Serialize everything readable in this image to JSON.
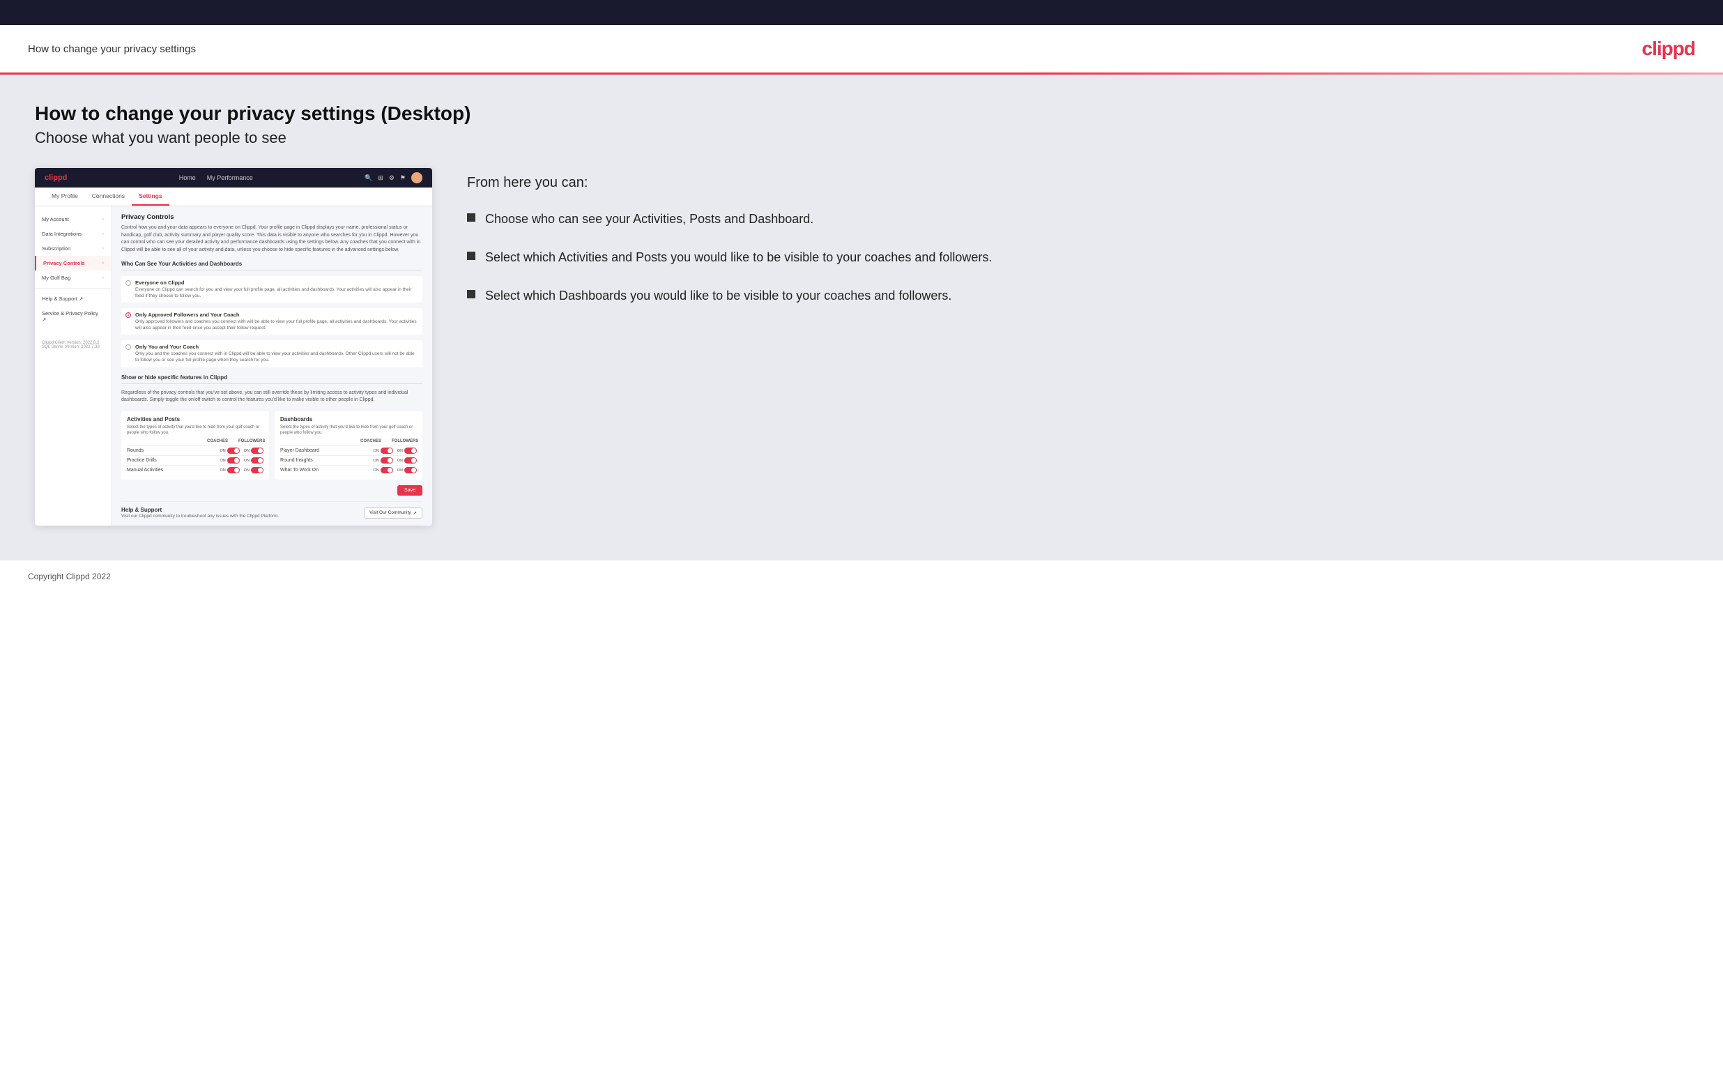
{
  "topbar": {},
  "header": {
    "title": "How to change your privacy settings",
    "logo": "clippd"
  },
  "main": {
    "heading": "How to change your privacy settings (Desktop)",
    "subheading": "Choose what you want people to see",
    "app_screenshot": {
      "navbar": {
        "logo": "clippd",
        "links": [
          "Home",
          "My Performance"
        ],
        "icons": [
          "search",
          "grid",
          "settings",
          "avatar"
        ]
      },
      "subnav": {
        "tabs": [
          "My Profile",
          "Connections",
          "Settings"
        ]
      },
      "sidebar": {
        "items": [
          {
            "label": "My Account",
            "active": false
          },
          {
            "label": "Data Integrations",
            "active": false
          },
          {
            "label": "Subscription",
            "active": false
          },
          {
            "label": "Privacy Controls",
            "active": true
          },
          {
            "label": "My Golf Bag",
            "active": false
          }
        ],
        "secondary": [
          {
            "label": "Help & Support"
          },
          {
            "label": "Service & Privacy Policy"
          }
        ],
        "footer": "Clippd Client Version: 2022.8.2\nSQL Server Version: 2022.7.38"
      },
      "panel": {
        "title": "Privacy Controls",
        "description": "Control how you and your data appears to everyone on Clippd. Your profile page in Clippd displays your name, professional status or handicap, golf club, activity summary and player quality score. This data is visible to anyone who searches for you in Clippd. However you can control who can see your detailed activity and performance dashboards using the settings below. Any coaches that you connect with in Clippd will be able to see all of your activity and data, unless you choose to hide specific features in the advanced settings below.",
        "visibility_title": "Who Can See Your Activities and Dashboards",
        "radio_options": [
          {
            "label": "Everyone on Clippd",
            "description": "Everyone on Clippd can search for you and view your full profile page, all activities and dashboards. Your activities will also appear in their feed if they choose to follow you.",
            "selected": false
          },
          {
            "label": "Only Approved Followers and Your Coach",
            "description": "Only approved followers and coaches you connect with will be able to view your full profile page, all activities and dashboards. Your activities will also appear in their feed once you accept their follow request.",
            "selected": true
          },
          {
            "label": "Only You and Your Coach",
            "description": "Only you and the coaches you connect with in Clippd will be able to view your activities and dashboards. Other Clippd users will not be able to follow you or see your full profile page when they search for you.",
            "selected": false
          }
        ],
        "toggle_section_title": "Show or hide specific features in Clippd",
        "toggle_section_desc": "Regardless of the privacy controls that you've set above, you can still override these by limiting access to activity types and individual dashboards. Simply toggle the on/off switch to control the features you'd like to make visible to other people in Clippd.",
        "activities_box": {
          "title": "Activities and Posts",
          "description": "Select the types of activity that you'd like to hide from your golf coach or people who follow you.",
          "col_labels": [
            "COACHES",
            "FOLLOWERS"
          ],
          "rows": [
            {
              "label": "Rounds",
              "coaches_on": true,
              "followers_on": true
            },
            {
              "label": "Practice Drills",
              "coaches_on": true,
              "followers_on": true
            },
            {
              "label": "Manual Activities",
              "coaches_on": true,
              "followers_on": true
            }
          ]
        },
        "dashboards_box": {
          "title": "Dashboards",
          "description": "Select the types of activity that you'd like to hide from your golf coach or people who follow you.",
          "col_labels": [
            "COACHES",
            "FOLLOWERS"
          ],
          "rows": [
            {
              "label": "Player Dashboard",
              "coaches_on": true,
              "followers_on": true
            },
            {
              "label": "Round Insights",
              "coaches_on": true,
              "followers_on": true
            },
            {
              "label": "What To Work On",
              "coaches_on": true,
              "followers_on": true
            }
          ]
        },
        "save_label": "Save",
        "help": {
          "title": "Help & Support",
          "description": "Visit our Clippd community to troubleshoot any issues with the Clippd Platform.",
          "button_label": "Visit Our Community"
        }
      }
    },
    "right_column": {
      "from_here": "From here you can:",
      "bullets": [
        "Choose who can see your Activities, Posts and Dashboard.",
        "Select which Activities and Posts you would like to be visible to your coaches and followers.",
        "Select which Dashboards you would like to be visible to your coaches and followers."
      ]
    }
  },
  "footer": {
    "copyright": "Copyright Clippd 2022"
  }
}
